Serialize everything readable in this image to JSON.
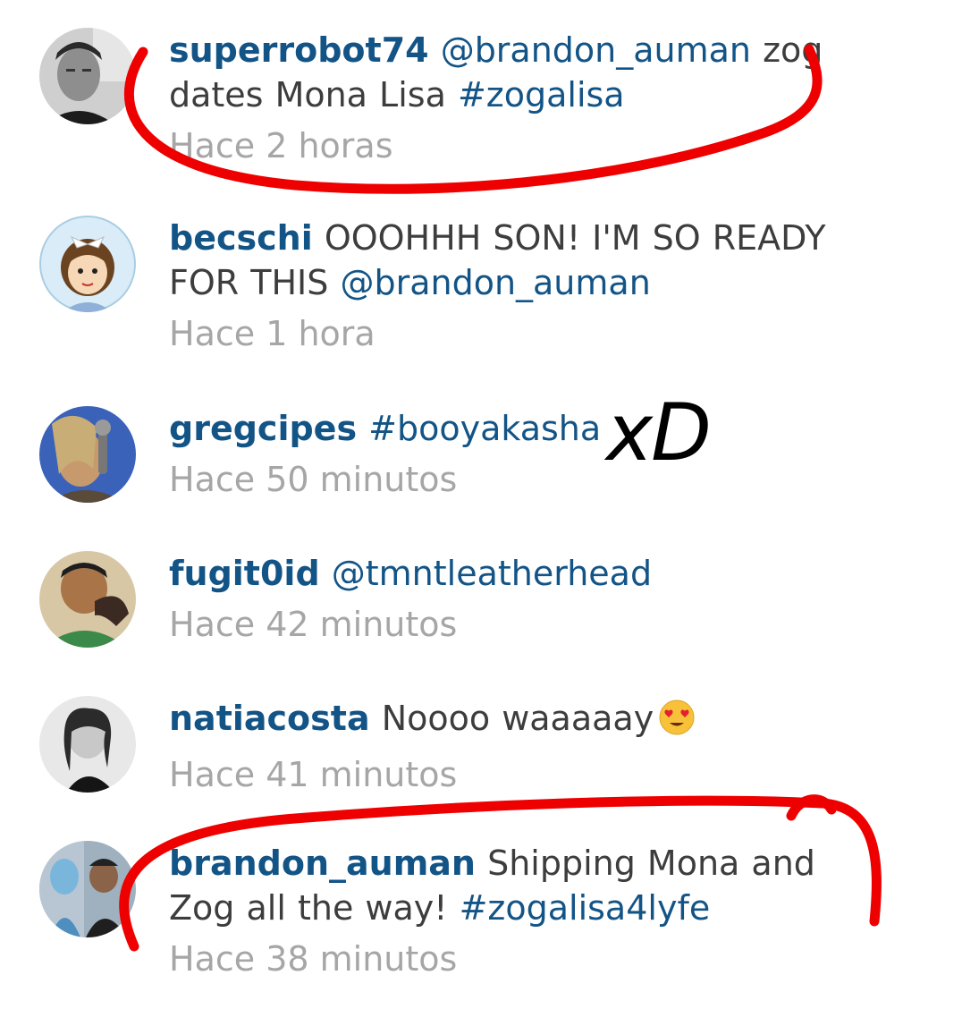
{
  "comments": [
    {
      "username": "superrobot74",
      "parts": [
        {
          "text": "@brandon_auman",
          "link": true
        },
        {
          "text": " zog dates Mona Lisa ",
          "link": false
        },
        {
          "text": "#zogalisa",
          "link": true
        }
      ],
      "time": "Hace 2 horas"
    },
    {
      "username": "becschi",
      "parts": [
        {
          "text": "OOOHHH SON! I'M SO READY FOR THIS ",
          "link": false
        },
        {
          "text": "@brandon_auman",
          "link": true
        }
      ],
      "time": "Hace 1 hora"
    },
    {
      "username": "gregcipes",
      "parts": [
        {
          "text": "#booyakasha",
          "link": true
        }
      ],
      "time": "Hace 50 minutos"
    },
    {
      "username": "fugit0id",
      "parts": [
        {
          "text": "@tmntleatherhead",
          "link": true
        }
      ],
      "time": "Hace 42 minutos"
    },
    {
      "username": "natiacosta",
      "parts": [
        {
          "text": "Noooo waaaaay",
          "link": false
        }
      ],
      "emoji": "heart-eyes-emoji",
      "time": "Hace 41 minutos"
    },
    {
      "username": "brandon_auman",
      "parts": [
        {
          "text": "Shipping Mona and Zog all the way! ",
          "link": false
        },
        {
          "text": "#zogalisa4lyfe",
          "link": true
        }
      ],
      "time": "Hace 38 minutos"
    }
  ],
  "annotation": {
    "handwritten_text": "xD",
    "ink_color": "#ee0000"
  },
  "colors": {
    "username": "#135487",
    "link": "#135487",
    "text": "#3d3d3d",
    "timestamp": "#a6a6a6"
  }
}
